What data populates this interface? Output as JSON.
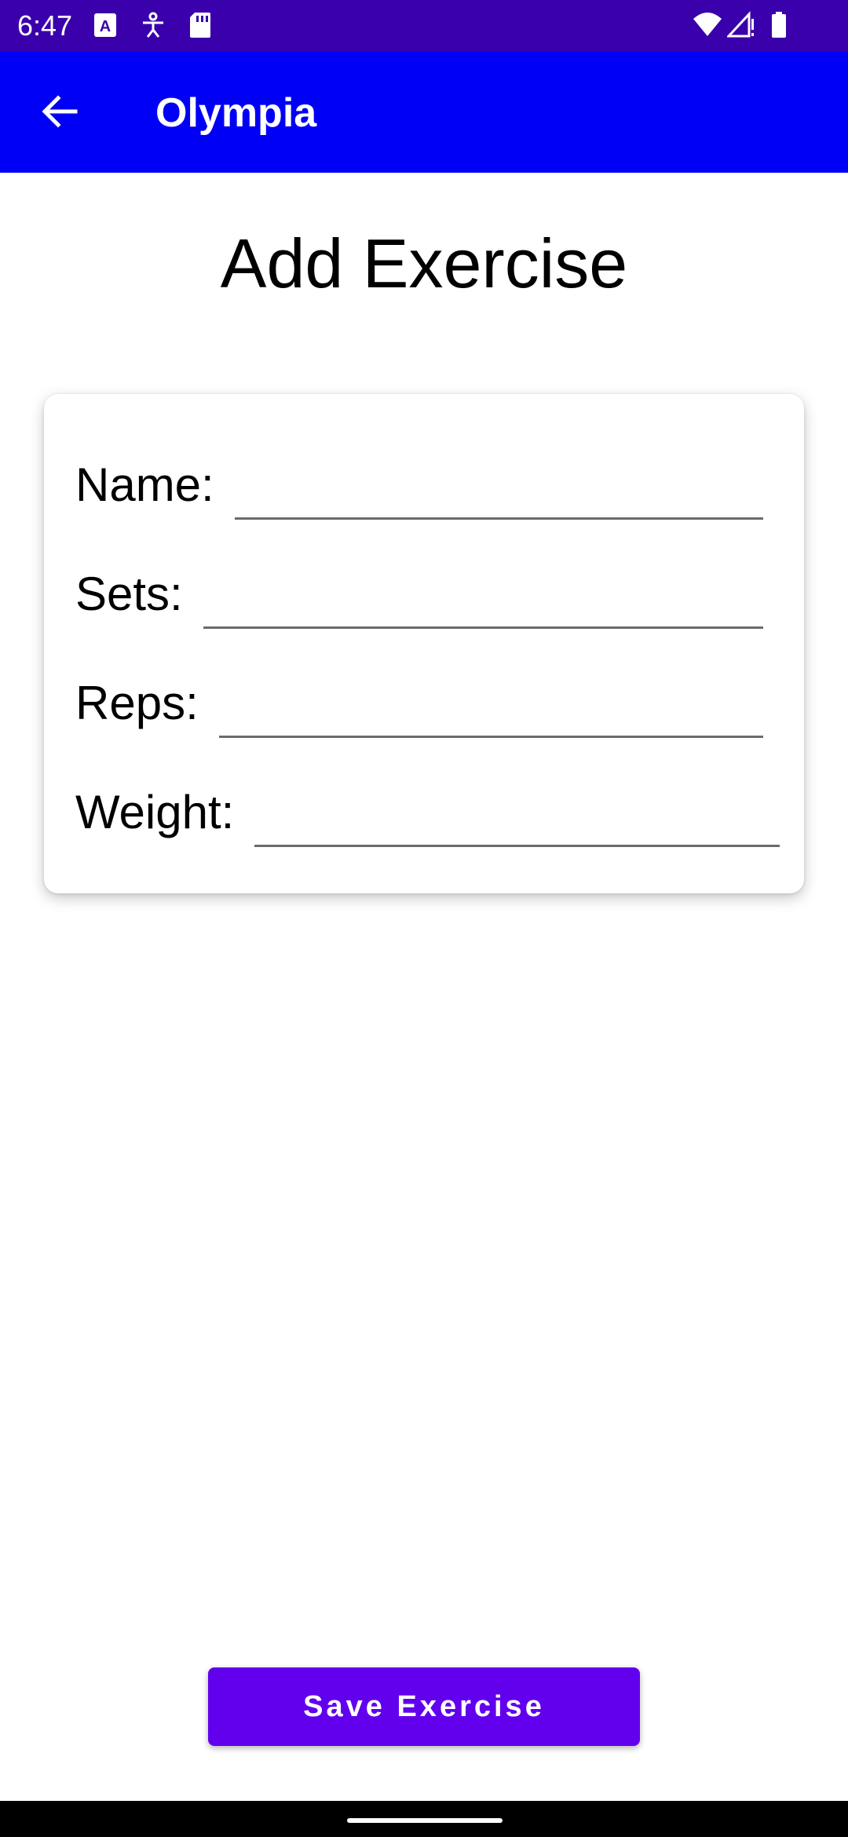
{
  "status_bar": {
    "time": "6:47",
    "icons": [
      "font-a-icon",
      "accessibility-icon",
      "sd-card-icon",
      "wifi-icon",
      "signal-icon",
      "battery-icon"
    ]
  },
  "app_bar": {
    "back_icon": "arrow-back-icon",
    "title": "Olympia",
    "color": "#0000f7"
  },
  "page": {
    "title": "Add Exercise"
  },
  "form": {
    "fields": [
      {
        "label": "Name:",
        "value": ""
      },
      {
        "label": "Sets:",
        "value": ""
      },
      {
        "label": "Reps:",
        "value": ""
      },
      {
        "label": "Weight:",
        "value": ""
      }
    ]
  },
  "save_button": {
    "label": "Save Exercise",
    "color": "#6200ee"
  }
}
